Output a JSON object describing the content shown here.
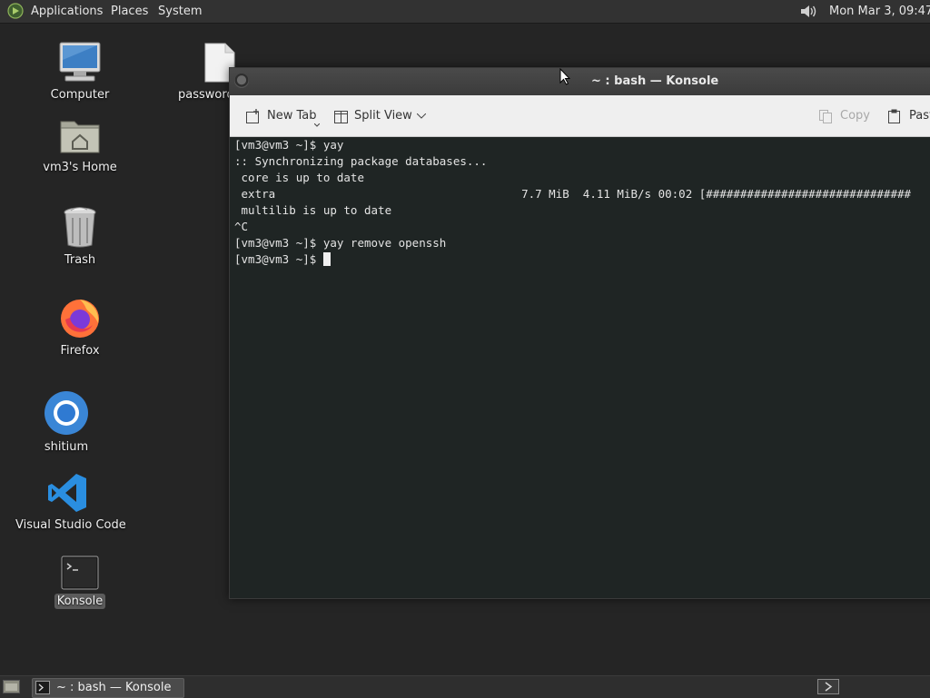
{
  "top_panel": {
    "menus": [
      "Applications",
      "Places",
      "System"
    ],
    "clock": "Mon Mar  3, 09:47"
  },
  "desktop_icons": [
    {
      "label": "Computer",
      "icon": "computer-icon"
    },
    {
      "label": "password",
      "icon": "file-icon"
    },
    {
      "label": "vm3's Home",
      "icon": "home-folder-icon"
    },
    {
      "label": "Trash",
      "icon": "trash-icon"
    },
    {
      "label": "Firefox",
      "icon": "firefox-icon"
    },
    {
      "label": "shitium",
      "icon": "chromium-icon"
    },
    {
      "label": "Visual Studio Code",
      "icon": "vscode-icon"
    },
    {
      "label": "Konsole",
      "icon": "terminal-icon",
      "selected": true
    }
  ],
  "window": {
    "title": "~ : bash — Konsole",
    "toolbar": {
      "new_tab": "New Tab",
      "split_view": "Split View",
      "copy": "Copy",
      "paste": "Past"
    }
  },
  "terminal": {
    "lines": [
      "[vm3@vm3 ~]$ yay",
      ":: Synchronizing package databases...",
      " core is up to date",
      " extra                                    7.7 MiB  4.11 MiB/s 00:02 [##############################",
      " multilib is up to date",
      "^C",
      "[vm3@vm3 ~]$ yay remove openssh",
      "[vm3@vm3 ~]$ "
    ]
  },
  "taskbar": {
    "task_label": "~ : bash — Konsole"
  },
  "colors": {
    "desktop_bg": "#252525",
    "terminal_bg": "#1f2524",
    "toolbar_bg": "#efefef"
  }
}
